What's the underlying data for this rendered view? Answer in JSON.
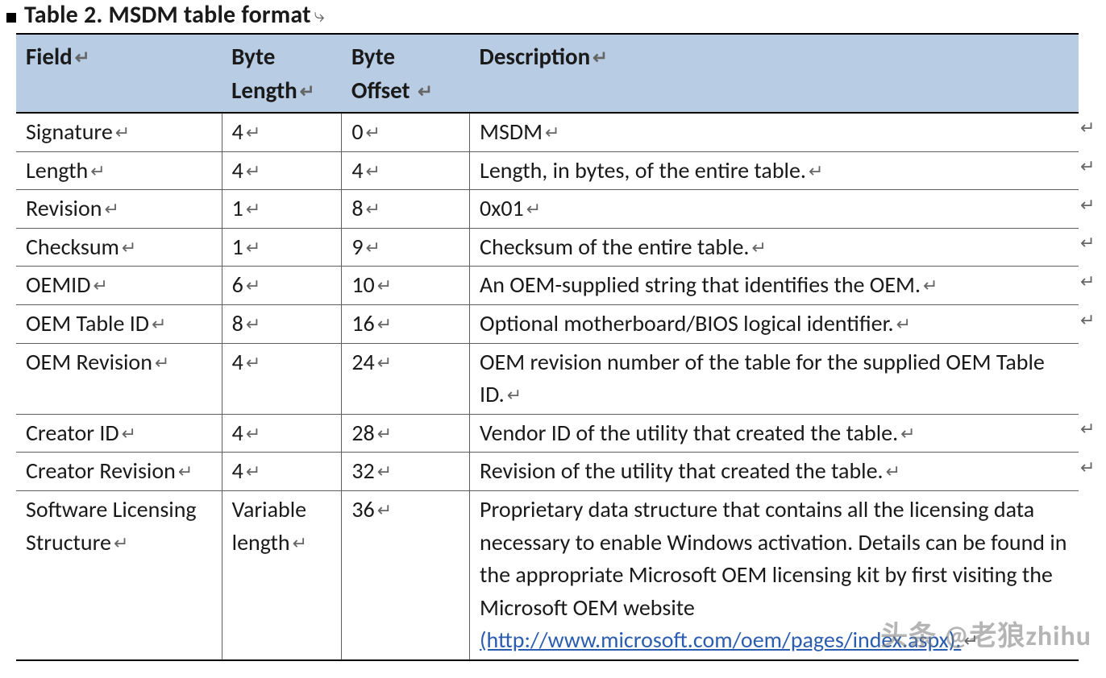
{
  "title": "Table 2. MSDM table format",
  "headers": {
    "field": "Field",
    "length": "Byte Length",
    "offset": "Byte Offset",
    "description": "Description"
  },
  "rows": [
    {
      "field": "Signature",
      "length": "4",
      "offset": "0",
      "description": "MSDM"
    },
    {
      "field": "Length",
      "length": "4",
      "offset": "4",
      "description": "Length, in bytes, of the entire table."
    },
    {
      "field": "Revision",
      "length": "1",
      "offset": "8",
      "description": "0x01"
    },
    {
      "field": "Checksum",
      "length": "1",
      "offset": "9",
      "description": "Checksum of the entire table."
    },
    {
      "field": "OEMID",
      "length": "6",
      "offset": "10",
      "description": "An OEM-supplied string that identifies the OEM."
    },
    {
      "field": "OEM Table ID",
      "length": "8",
      "offset": "16",
      "description": "Optional motherboard/BIOS logical identifier."
    },
    {
      "field": "OEM Revision",
      "length": "4",
      "offset": "24",
      "description": "OEM revision number of the table for the supplied OEM Table ID."
    },
    {
      "field": "Creator ID",
      "length": "4",
      "offset": "28",
      "description": "Vendor ID of the utility that created the table."
    },
    {
      "field": "Creator Revision",
      "length": "4",
      "offset": "32",
      "description": "Revision of the utility that created the table."
    },
    {
      "field": "Software Licensing Structure",
      "length": "Variable length",
      "offset": "36",
      "description": "Proprietary data structure that contains all the licensing data necessary to enable Windows activation. Details can be found in the appropriate Microsoft OEM licensing kit by first visiting the Microsoft OEM website ",
      "link": "(http://www.microsoft.com/oem/pages/index.aspx)."
    }
  ],
  "watermark": "头条 @老狼zhihu"
}
